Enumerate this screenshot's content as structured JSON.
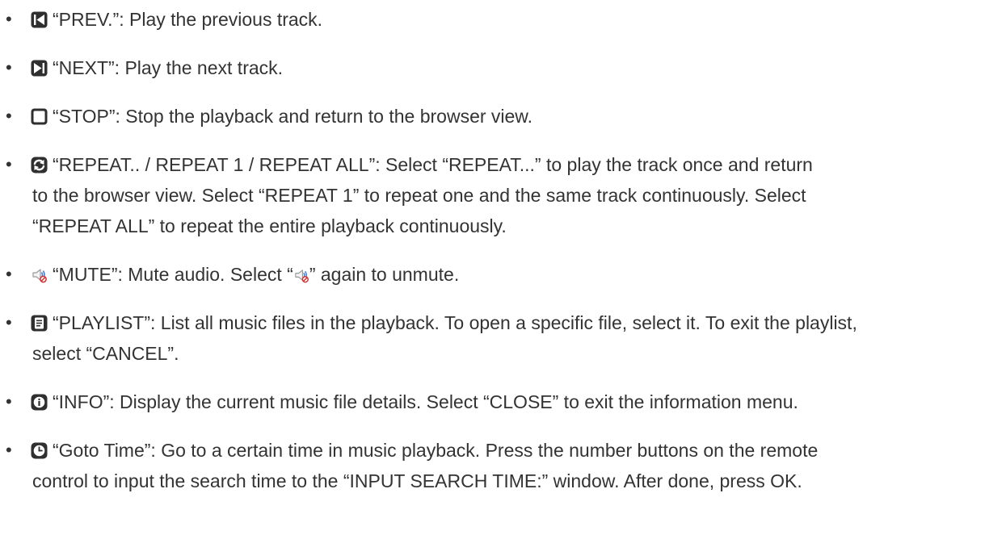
{
  "bullet": "•",
  "items": [
    {
      "icon": "prev-track-icon",
      "lines": [
        "“PREV.”: Play the previous track."
      ]
    },
    {
      "icon": "next-track-icon",
      "lines": [
        "“NEXT”: Play the next track."
      ]
    },
    {
      "icon": "stop-icon",
      "lines": [
        "“STOP”: Stop the playback and return to the browser view."
      ]
    },
    {
      "icon": "repeat-icon",
      "lines": [
        "“REPEAT.. / REPEAT 1 / REPEAT ALL”: Select “REPEAT...” to play the track once and return",
        "to the browser view. Select “REPEAT 1” to repeat one and the same track continuously. Select",
        "“REPEAT ALL” to repeat the entire playback continuously."
      ]
    },
    {
      "icon": "mute-icon",
      "line_parts": [
        "“MUTE”: Mute audio. Select “",
        "” again to unmute."
      ]
    },
    {
      "icon": "playlist-icon",
      "lines": [
        "“PLAYLIST”: List all music files in the playback. To open a specific file, select it. To exit the playlist,",
        "select “CANCEL”."
      ]
    },
    {
      "icon": "info-icon",
      "lines": [
        "“INFO”: Display the current music file details. Select “CLOSE” to exit the information menu."
      ]
    },
    {
      "icon": "goto-time-icon",
      "lines": [
        "“Goto Time”: Go to a certain time in music playback. Press the number buttons on the remote",
        "control to input the search time to the “INPUT SEARCH TIME:” window. After done, press OK."
      ]
    }
  ]
}
